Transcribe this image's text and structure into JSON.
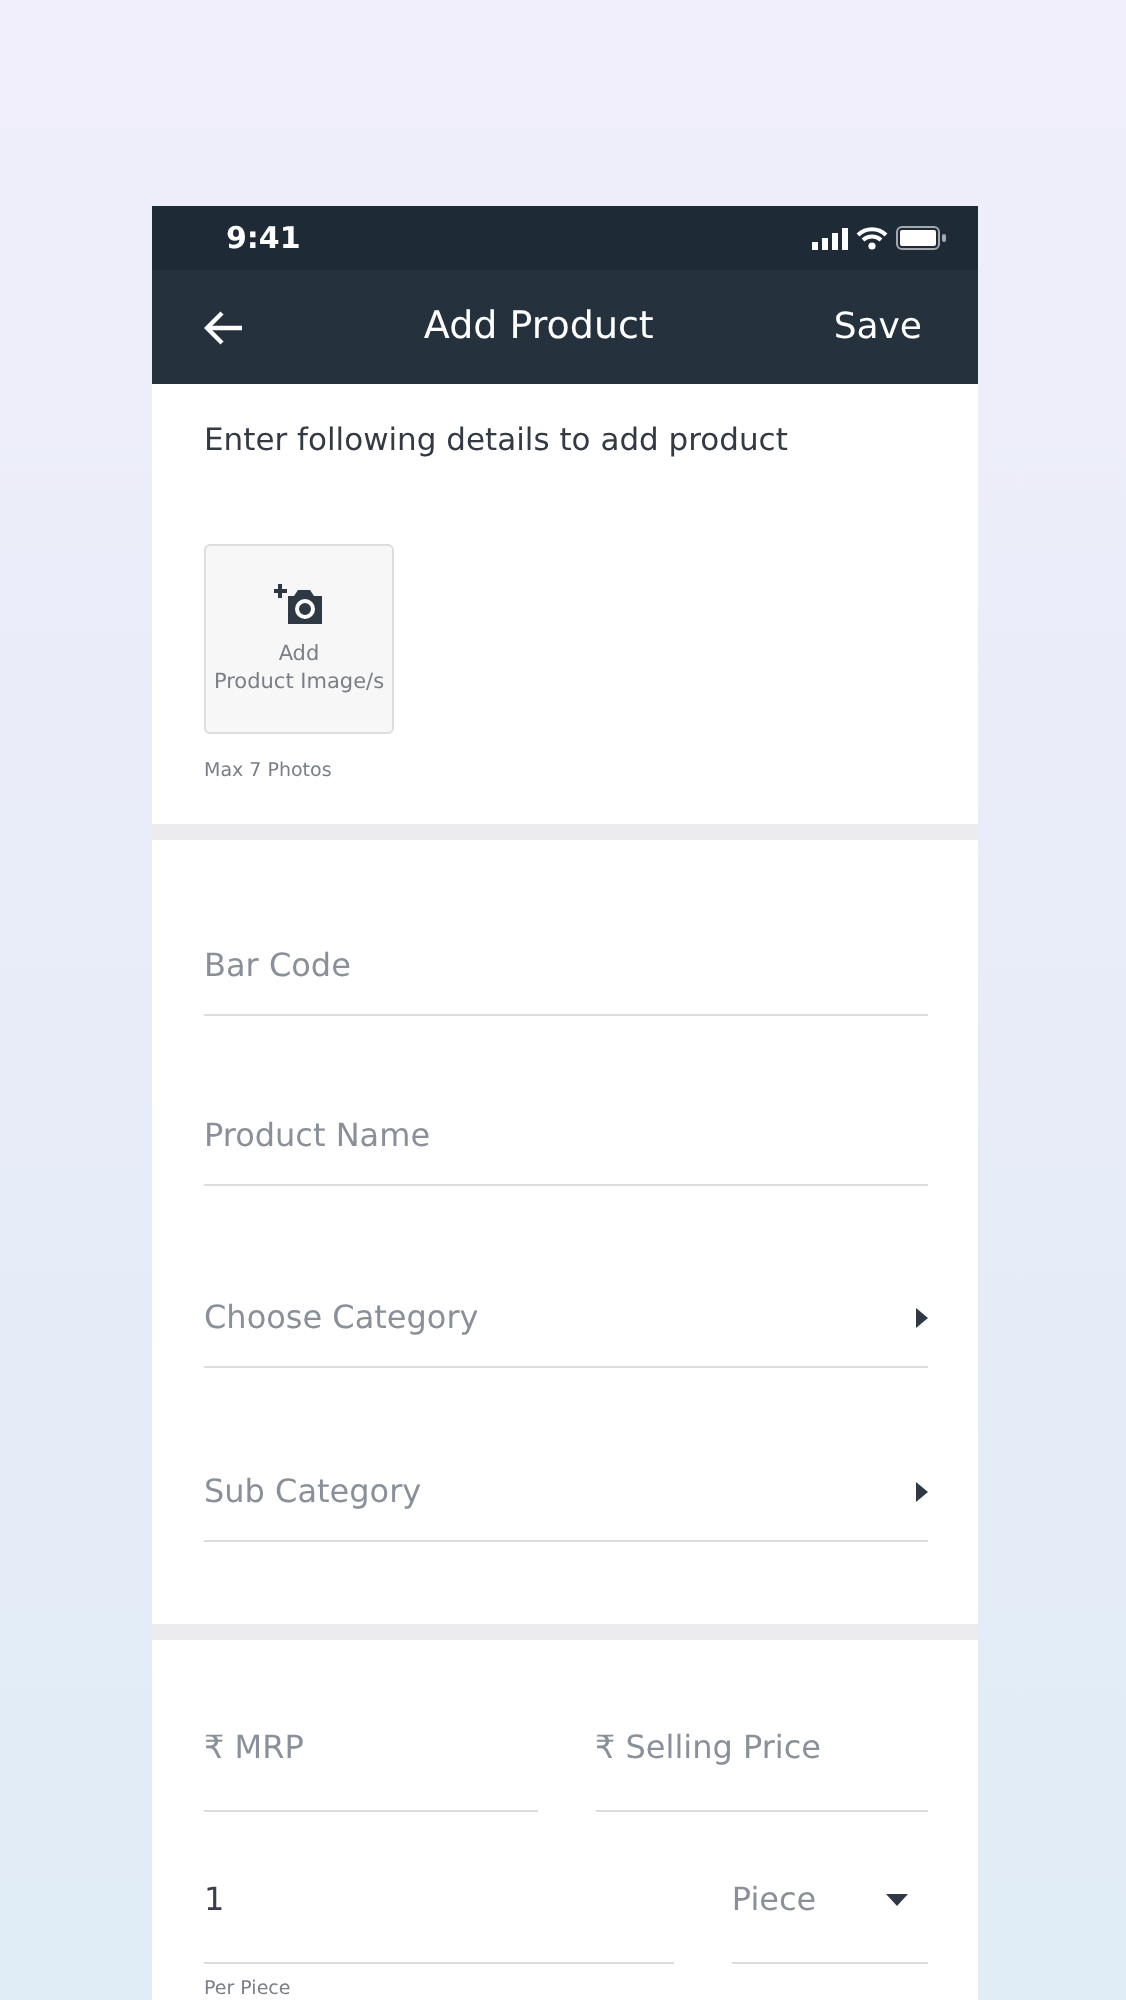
{
  "status_bar": {
    "time": "9:41"
  },
  "header": {
    "title": "Add Product",
    "action": "Save"
  },
  "intro": "Enter following details to add product",
  "image_upload": {
    "label_lines": [
      "Add",
      "Product Image/s"
    ],
    "note": "Max 7 Photos"
  },
  "fields": [
    {
      "kind": "text",
      "placeholder": "Bar Code"
    },
    {
      "kind": "text",
      "placeholder": "Product Name"
    },
    {
      "kind": "picker",
      "placeholder": "Choose Category"
    },
    {
      "kind": "picker",
      "placeholder": "Sub Category"
    }
  ],
  "price_fields": [
    {
      "placeholder": "₹ MRP"
    },
    {
      "placeholder": "₹ Selling Price"
    }
  ],
  "quantity": {
    "value": "1",
    "hint": "Per Piece"
  },
  "unit": {
    "value": "Piece"
  }
}
